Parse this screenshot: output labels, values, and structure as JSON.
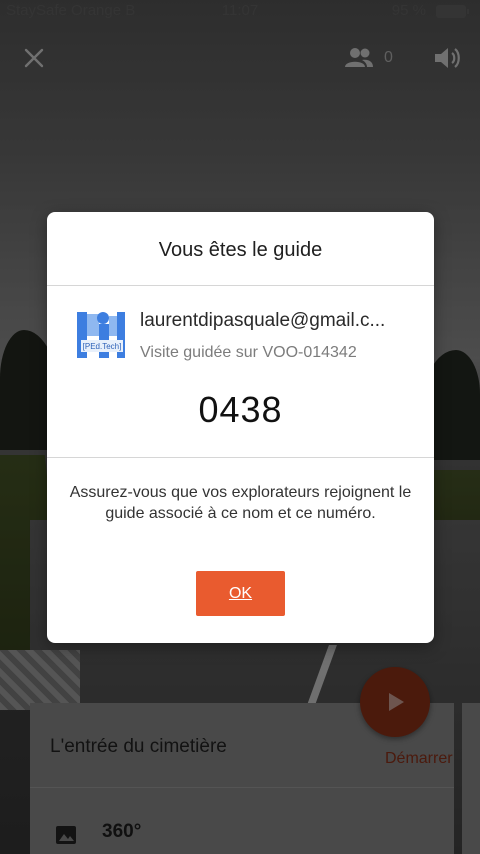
{
  "status_bar": {
    "carrier": "StaySafe Orange B",
    "time": "11:07",
    "battery": "95 %"
  },
  "top_bar": {
    "close_icon": "close-icon",
    "people_icon": "people-icon",
    "participant_count": "0",
    "volume_icon": "volume-icon"
  },
  "dialog": {
    "title": "Vous êtes le guide",
    "logo_text": "[PEd.Tech]",
    "email": "laurentdipasquale@gmail.c...",
    "subtitle": "Visite guidée sur VOO-014342",
    "code": "0438",
    "message": "Assurez-vous que vos explorateurs rejoignent le guide associé à ce nom et ce numéro.",
    "ok_label": "OK",
    "accent_color": "#e95b2f"
  },
  "card": {
    "title": "L'entrée du cimetière",
    "start_label": "Démarrer",
    "image_icon": "image-icon",
    "type_label": "360°"
  },
  "fab": {
    "icon": "play-icon"
  }
}
